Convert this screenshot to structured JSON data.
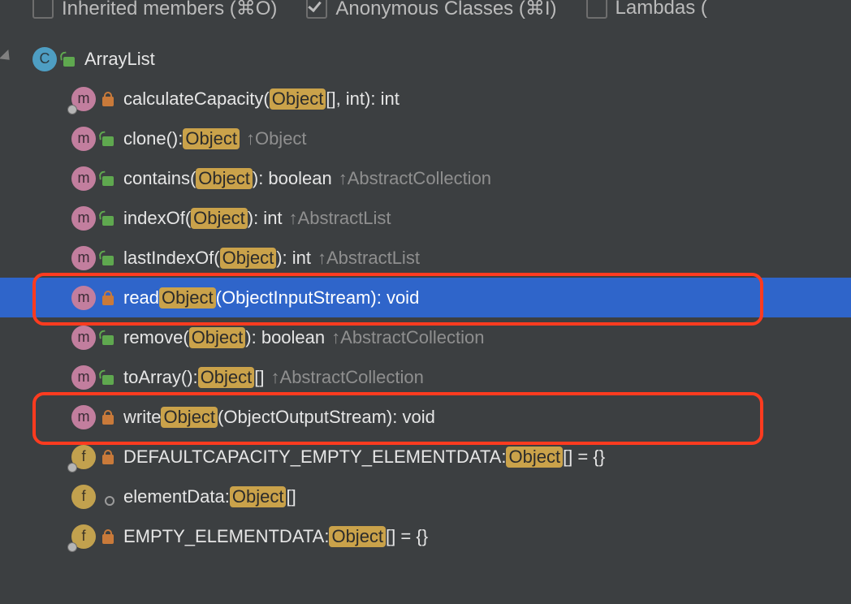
{
  "toolbar": {
    "inherited": {
      "label": "Inherited members (⌘O)",
      "checked": false
    },
    "anonymous": {
      "label": "Anonymous Classes (⌘I)",
      "checked": true
    },
    "lambdas": {
      "label": "Lambdas (",
      "checked": false
    }
  },
  "highlight": "Object",
  "class": {
    "name": "ArrayList"
  },
  "members": [
    {
      "icon": "m",
      "access": "lock",
      "pin": true,
      "pre": "calculateCapacity(",
      "hl": "Object",
      "post": "[], int): int"
    },
    {
      "icon": "m",
      "access": "open",
      "pre": "clone(): ",
      "hl": "Object",
      "post": "",
      "inh": "Object"
    },
    {
      "icon": "m",
      "access": "open",
      "pre": "contains(",
      "hl": "Object",
      "post": "): boolean",
      "inh": "AbstractCollection"
    },
    {
      "icon": "m",
      "access": "open",
      "pre": "indexOf(",
      "hl": "Object",
      "post": "): int",
      "inh": "AbstractList"
    },
    {
      "icon": "m",
      "access": "open",
      "pre": "lastIndexOf(",
      "hl": "Object",
      "post": "): int",
      "inh": "AbstractList"
    },
    {
      "icon": "m",
      "access": "lock",
      "pre": "read",
      "hl": "Object",
      "post": "(ObjectInputStream): void",
      "selected": true,
      "annotated": true
    },
    {
      "icon": "m",
      "access": "open",
      "pre": "remove(",
      "hl": "Object",
      "post": "): boolean",
      "inh": "AbstractCollection"
    },
    {
      "icon": "m",
      "access": "open",
      "pre": "toArray(): ",
      "hl": "Object",
      "post": "[]",
      "inh": "AbstractCollection"
    },
    {
      "icon": "m",
      "access": "lock",
      "pre": "write",
      "hl": "Object",
      "post": "(ObjectOutputStream): void",
      "annotated": true
    },
    {
      "icon": "f",
      "access": "lock",
      "pin": true,
      "pre": "DEFAULTCAPACITY_EMPTY_ELEMENTDATA: ",
      "hl": "Object",
      "post": "[] = {}"
    },
    {
      "icon": "f",
      "access": "dot",
      "pre": "elementData: ",
      "hl": "Object",
      "post": "[]"
    },
    {
      "icon": "f",
      "access": "lock",
      "pin": true,
      "pre": "EMPTY_ELEMENTDATA: ",
      "hl": "Object",
      "post": "[] = {}"
    }
  ]
}
